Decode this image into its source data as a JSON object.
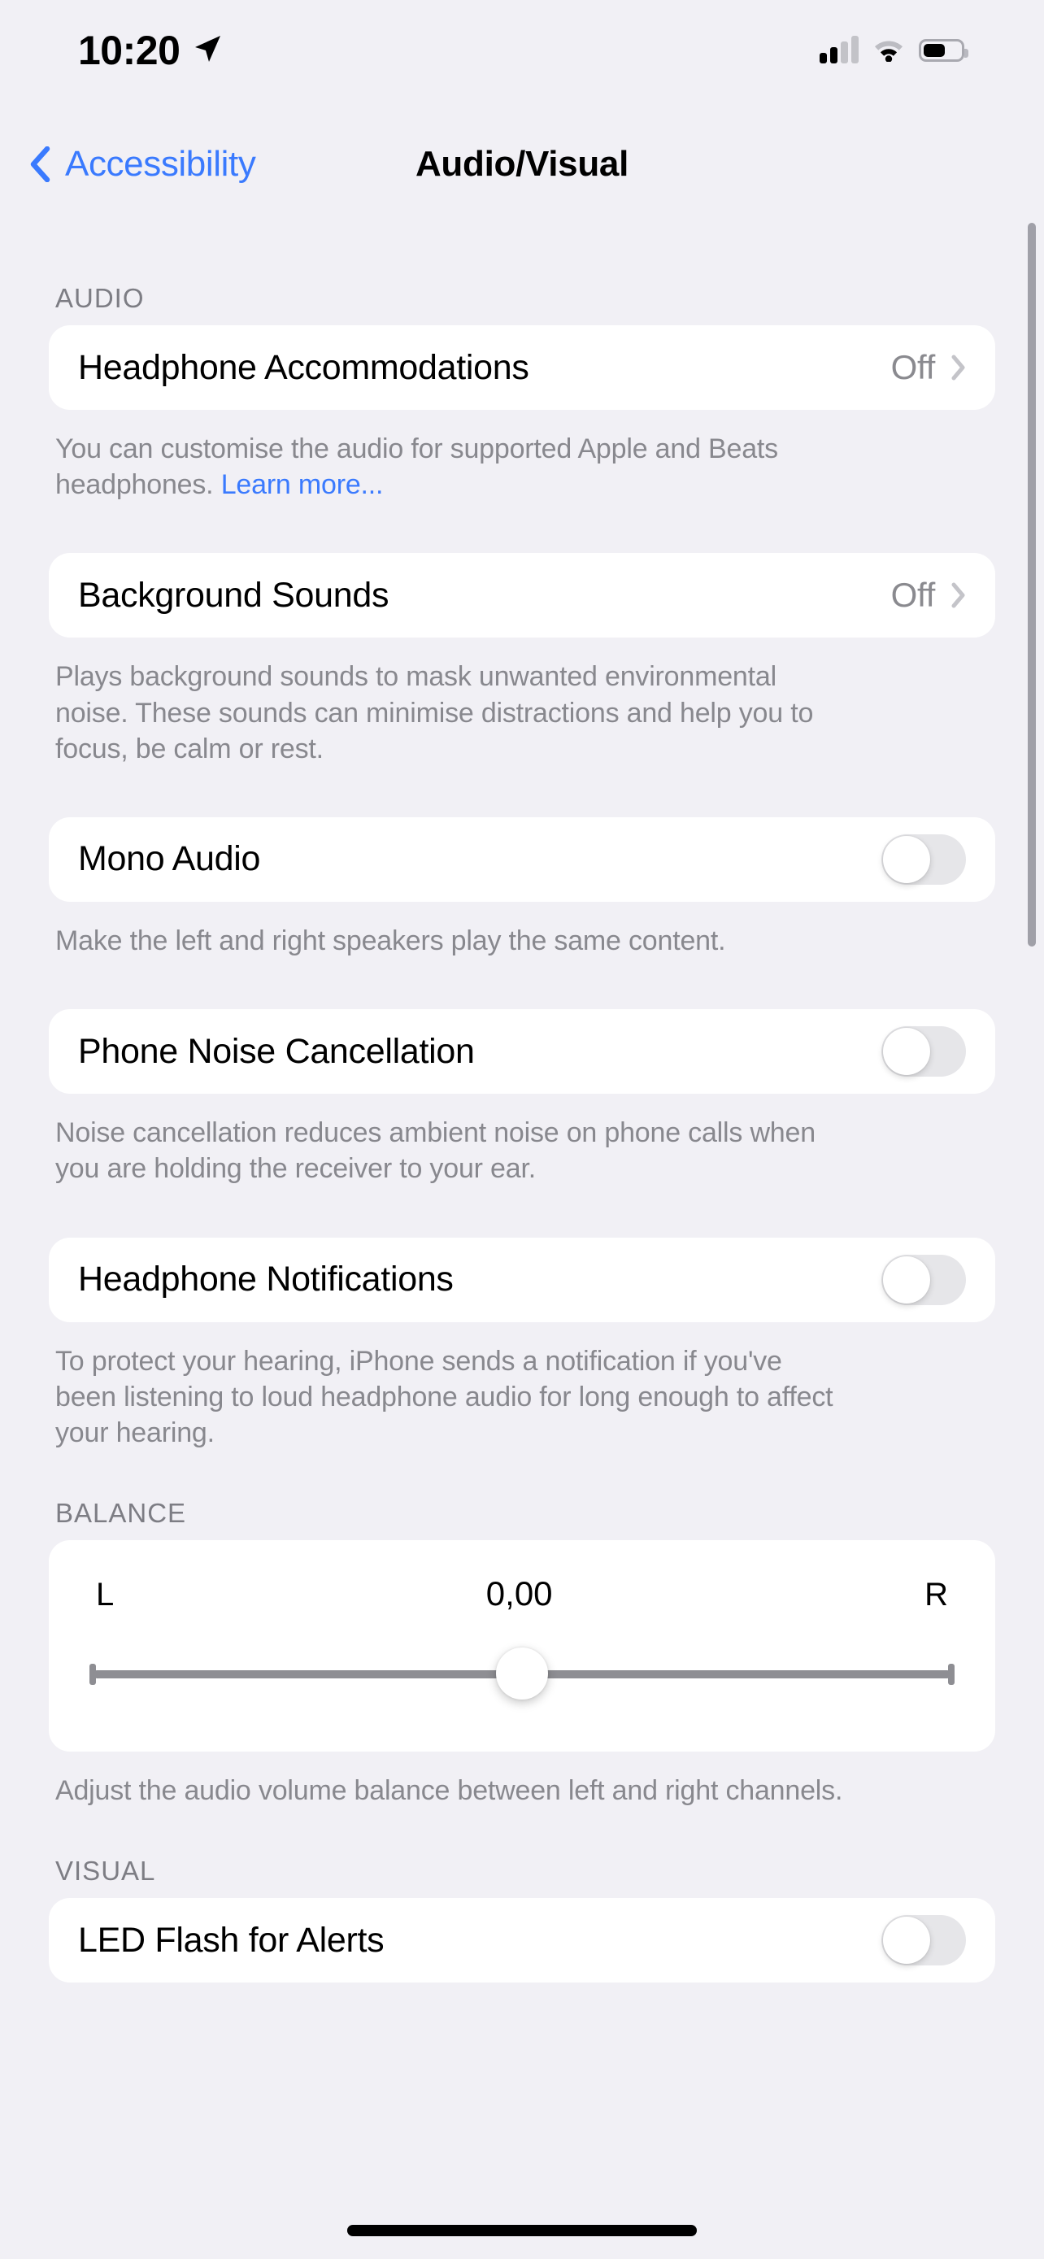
{
  "status_bar": {
    "time": "10:20",
    "location_icon": "location-arrow-icon",
    "cellular_icon": "cellular-signal-icon",
    "wifi_icon": "wifi-icon",
    "battery_icon": "battery-icon"
  },
  "nav": {
    "back_label": "Accessibility",
    "back_icon": "chevron-left-icon",
    "title": "Audio/Visual"
  },
  "sections": [
    {
      "header": "AUDIO",
      "rows": [
        {
          "label": "Headphone Accommodations",
          "value": "Off",
          "accessory": "chevron-right-icon",
          "footer_text": "You can customise the audio for supported Apple and Beats headphones. ",
          "footer_link": "Learn more..."
        },
        {
          "label": "Background Sounds",
          "value": "Off",
          "accessory": "chevron-right-icon",
          "footer_text": "Plays background sounds to mask unwanted environmental noise. These sounds can minimise distractions and help you to focus, be calm or rest."
        },
        {
          "label": "Mono Audio",
          "toggle": "off",
          "footer_text": "Make the left and right speakers play the same content."
        },
        {
          "label": "Phone Noise Cancellation",
          "toggle": "off",
          "footer_text": "Noise cancellation reduces ambient noise on phone calls when you are holding the receiver to your ear."
        },
        {
          "label": "Headphone Notifications",
          "toggle": "off",
          "footer_text": "To protect your hearing, iPhone sends a notification if you've been listening to loud headphone audio for long enough to affect your hearing."
        }
      ]
    },
    {
      "header": "BALANCE",
      "balance": {
        "left_label": "L",
        "value_label": "0,00",
        "right_label": "R",
        "position_percent": 50
      },
      "footer_text": "Adjust the audio volume balance between left and right channels."
    },
    {
      "header": "VISUAL",
      "rows": [
        {
          "label": "LED Flash for Alerts",
          "toggle": "off"
        }
      ]
    }
  ],
  "colors": {
    "accent_blue": "#3a7afe",
    "background": "#f1f0f5",
    "card": "#ffffff",
    "secondary_text": "#88888e",
    "toggle_off_track": "#e6e6e9"
  }
}
